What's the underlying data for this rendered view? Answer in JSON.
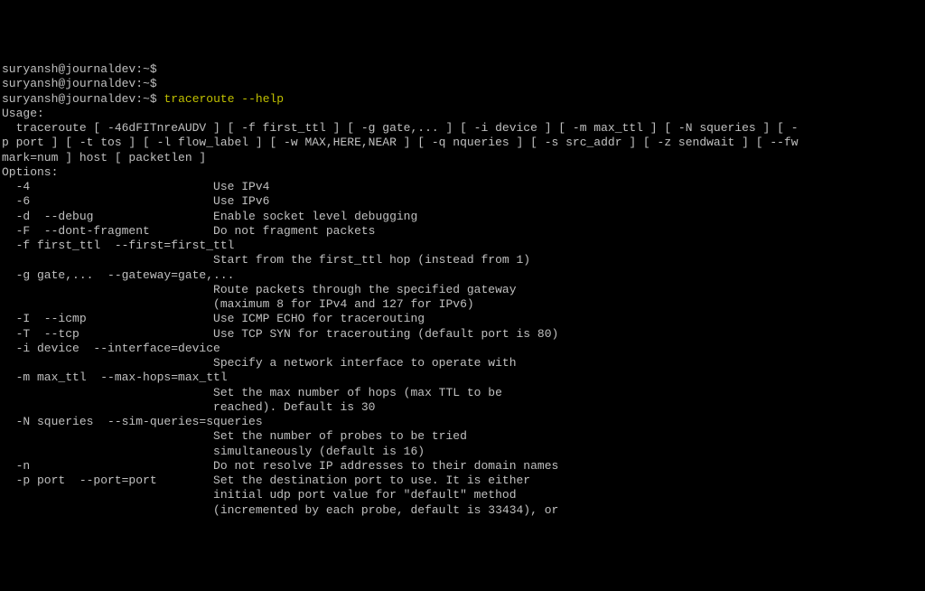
{
  "prompts": [
    {
      "user": "suryansh@journaldev",
      "path": "~",
      "symbol": "$",
      "command": ""
    },
    {
      "user": "suryansh@journaldev",
      "path": "~",
      "symbol": "$",
      "command": ""
    },
    {
      "user": "suryansh@journaldev",
      "path": "~",
      "symbol": "$",
      "command": "traceroute --help"
    }
  ],
  "output_lines": [
    "Usage:",
    "  traceroute [ -46dFITnreAUDV ] [ -f first_ttl ] [ -g gate,... ] [ -i device ] [ -m max_ttl ] [ -N squeries ] [ -",
    "p port ] [ -t tos ] [ -l flow_label ] [ -w MAX,HERE,NEAR ] [ -q nqueries ] [ -s src_addr ] [ -z sendwait ] [ --fw",
    "mark=num ] host [ packetlen ]",
    "Options:",
    "  -4                          Use IPv4",
    "  -6                          Use IPv6",
    "  -d  --debug                 Enable socket level debugging",
    "  -F  --dont-fragment         Do not fragment packets",
    "  -f first_ttl  --first=first_ttl",
    "                              Start from the first_ttl hop (instead from 1)",
    "  -g gate,...  --gateway=gate,...",
    "                              Route packets through the specified gateway",
    "                              (maximum 8 for IPv4 and 127 for IPv6)",
    "  -I  --icmp                  Use ICMP ECHO for tracerouting",
    "  -T  --tcp                   Use TCP SYN for tracerouting (default port is 80)",
    "  -i device  --interface=device",
    "                              Specify a network interface to operate with",
    "  -m max_ttl  --max-hops=max_ttl",
    "                              Set the max number of hops (max TTL to be",
    "                              reached). Default is 30",
    "  -N squeries  --sim-queries=squeries",
    "                              Set the number of probes to be tried",
    "                              simultaneously (default is 16)",
    "  -n                          Do not resolve IP addresses to their domain names",
    "  -p port  --port=port        Set the destination port to use. It is either",
    "                              initial udp port value for \"default\" method",
    "                              (incremented by each probe, default is 33434), or"
  ]
}
